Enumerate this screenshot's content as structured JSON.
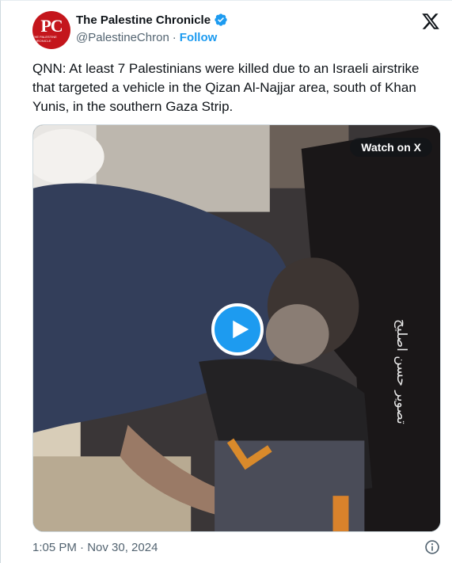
{
  "author": {
    "avatar_text": "PC",
    "avatar_subtext": "The Palestine Chronicle",
    "display_name": "The Palestine Chronicle",
    "handle": "@PalestineChron",
    "separator": "·",
    "follow_label": "Follow",
    "verified_icon": "verified-badge-icon",
    "brand_color": "#c4161c"
  },
  "header": {
    "logo_icon": "x-logo-icon"
  },
  "tweet": {
    "text": "QNN: At least 7 Palestinians were killed due to an Israeli airstrike that targeted a vehicle in the Qizan Al-Najjar area, south of Khan Yunis, in the southern Gaza Strip."
  },
  "media": {
    "watch_label": "Watch on X",
    "play_icon": "play-icon",
    "caption_overlay": "تصوير حسن اصليح"
  },
  "footer": {
    "timestamp": "1:05 PM · Nov 30, 2024",
    "info_icon": "info-icon"
  },
  "colors": {
    "accent": "#1d9bf0",
    "text": "#0f1419",
    "muted": "#536471"
  }
}
